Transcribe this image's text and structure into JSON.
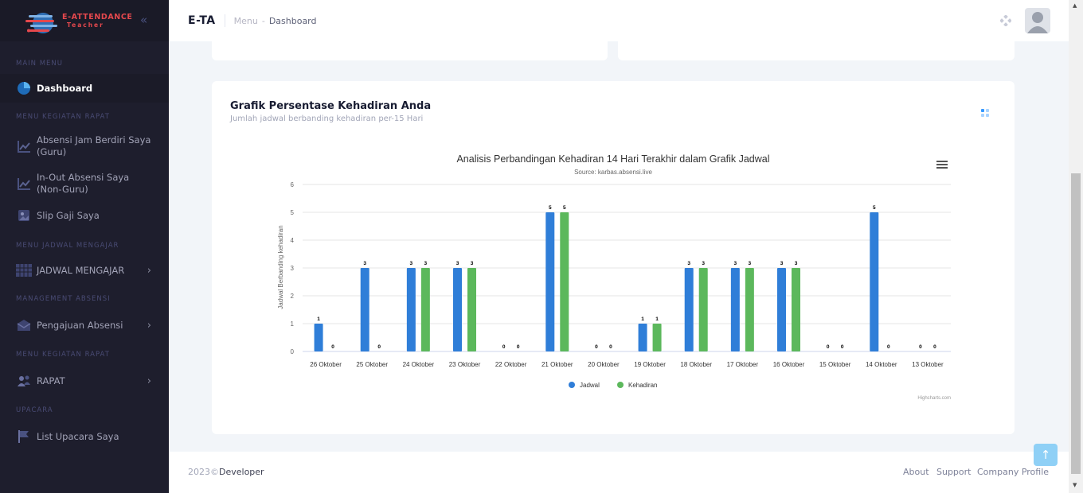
{
  "brand": {
    "logo_line1": "E-ATTENDANCE",
    "logo_line2": "Teacher",
    "short": "E-TA"
  },
  "breadcrumb": {
    "parent": "Menu",
    "sep": "-",
    "current": "Dashboard"
  },
  "sidebar": {
    "sections": [
      "MAIN MENU",
      "MENU KEGIATAN RAPAT",
      "MENU JADWAL MENGAJAR",
      "MANAGEMENT ABSENSI",
      "MENU KEGIATAN RAPAT",
      "UPACARA"
    ],
    "items": [
      {
        "label": "Dashboard",
        "icon": "pie-chart-icon"
      },
      {
        "label_1": "Absensi Jam Berdiri Saya",
        "label_2": "(Guru)",
        "icon": "line-chart-icon"
      },
      {
        "label_1": "In-Out Absensi Saya",
        "label_2": "(Non-Guru)",
        "icon": "line-chart-icon"
      },
      {
        "label": "Slip Gaji Saya",
        "icon": "image-icon"
      },
      {
        "label": "JADWAL MENGAJAR",
        "icon": "calendar-icon",
        "arrow": "›"
      },
      {
        "label": "Pengajuan Absensi",
        "icon": "envelope-icon",
        "arrow": "›"
      },
      {
        "label": "RAPAT",
        "icon": "group-icon",
        "arrow": "›"
      },
      {
        "label": "List Upacara Saya",
        "icon": "flag-icon"
      }
    ]
  },
  "card": {
    "title": "Grafik Persentase Kehadiran Anda",
    "subtitle": "Jumlah jadwal berbanding kehadiran per-15 Hari"
  },
  "chart_data": {
    "type": "bar",
    "title": "Analisis Perbandingan Kehadiran 14 Hari Terakhir dalam Grafik Jadwal",
    "subtitle": "Source: karbas.absensi.live",
    "xlabel": "",
    "ylabel": "Jadwal Berbanding kehadiran",
    "ylim": [
      0,
      6
    ],
    "yticks": [
      0,
      1,
      2,
      3,
      4,
      5,
      6
    ],
    "categories": [
      "26 Oktober",
      "25 Oktober",
      "24 Oktober",
      "23 Oktober",
      "22 Oktober",
      "21 Oktober",
      "20 Oktober",
      "19 Oktober",
      "18 Oktober",
      "17 Oktober",
      "16 Oktober",
      "15 Oktober",
      "14 Oktober",
      "13 Oktober"
    ],
    "series": [
      {
        "name": "Jadwal",
        "color": "#2f7ed8",
        "values": [
          1,
          3,
          3,
          3,
          0,
          5,
          0,
          1,
          3,
          3,
          3,
          0,
          5,
          0
        ]
      },
      {
        "name": "Kehadiran",
        "color": "#5cb85c",
        "values": [
          0,
          0,
          3,
          3,
          0,
          5,
          0,
          1,
          3,
          3,
          3,
          0,
          0,
          0
        ]
      }
    ],
    "legend": "bottom-center",
    "credits": "Highcharts.com",
    "grid": true
  },
  "footer": {
    "year": "2023©",
    "developer": "Developer",
    "links": [
      "About",
      "Support",
      "Company Profile"
    ]
  },
  "scroll_top_icon": "arrow-up-icon"
}
